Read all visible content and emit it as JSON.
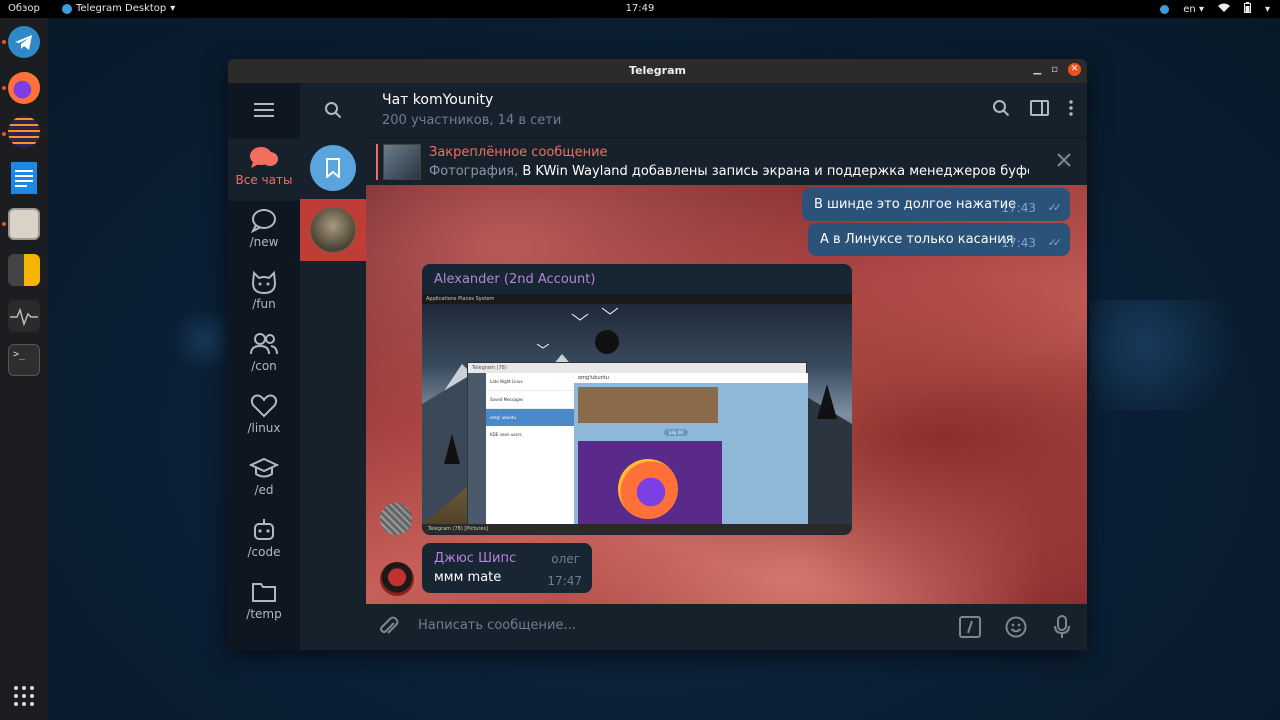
{
  "topbar": {
    "overview": "Обзор",
    "app_name": "Telegram Desktop",
    "clock": "17:49",
    "lang": "en"
  },
  "window": {
    "title": "Telegram"
  },
  "folders": [
    {
      "label": "Все чаты",
      "icon": "chats-icon",
      "active": true
    },
    {
      "label": "/new",
      "icon": "chat-bubble-icon"
    },
    {
      "label": "/fun",
      "icon": "cat-icon"
    },
    {
      "label": "/con",
      "icon": "people-icon"
    },
    {
      "label": "/linux",
      "icon": "heart-icon"
    },
    {
      "label": "/ed",
      "icon": "graduation-cap-icon"
    },
    {
      "label": "/code",
      "icon": "robot-icon"
    },
    {
      "label": "/temp",
      "icon": "folder-icon"
    }
  ],
  "chat": {
    "name": "Чат komYounity",
    "subtitle": "200 участников, 14 в сети"
  },
  "pinned": {
    "title": "Закреплённое сообщение",
    "kind": "Фотография, ",
    "text": "В KWin Wayland добавлены запись экрана и поддержка менеджеров буфера обме..."
  },
  "messages": {
    "out1": {
      "text": "В шинде это долгое нажатие",
      "time": "17:43"
    },
    "out2": {
      "text": "А в Линуксе только касания",
      "time": "17:43"
    },
    "photo": {
      "author": "Alexander (2nd Account)"
    },
    "last": {
      "author": "Джюс Шипс",
      "role": "олег",
      "text": "ммм mate",
      "time": "17:47"
    }
  },
  "screenshot": {
    "topstrip": "Applications  Places  System",
    "window_title": "Telegram (78)",
    "chat_title": "omg!ubuntu",
    "items": [
      "Late Night Linux",
      "Saved Messages",
      "omg! ubuntu",
      "KDE neon users"
    ],
    "date_pill": "July 28",
    "taskbar": "Telegram (78)     [Pictures]"
  },
  "composer": {
    "placeholder": "Написать сообщение..."
  },
  "colors": {
    "accent": "#f36e5e",
    "outgoing": "#2b5278",
    "incoming": "#182533",
    "link_name": "#b486d8"
  }
}
